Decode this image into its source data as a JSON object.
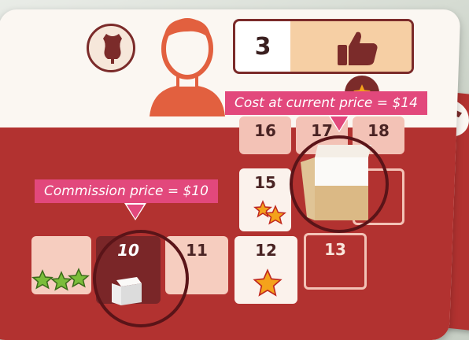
{
  "annotations": {
    "cost_callout": "Cost at current price = $14",
    "commission_callout": "Commission price = $10"
  },
  "counter": {
    "value": "3",
    "icon": "thumbs-up-icon"
  },
  "track": {
    "tiles": [
      "16",
      "17",
      "18",
      "15",
      "10",
      "11",
      "12",
      "13"
    ]
  },
  "colors": {
    "board_red": "#b23230",
    "tile_pink": "#f3c2b6",
    "dark_tile": "#7a2628",
    "callout_pink": "#e2487c",
    "ring": "#5a1418",
    "star_fill": "#f4a21b",
    "green_star": "#7bbd3a"
  }
}
